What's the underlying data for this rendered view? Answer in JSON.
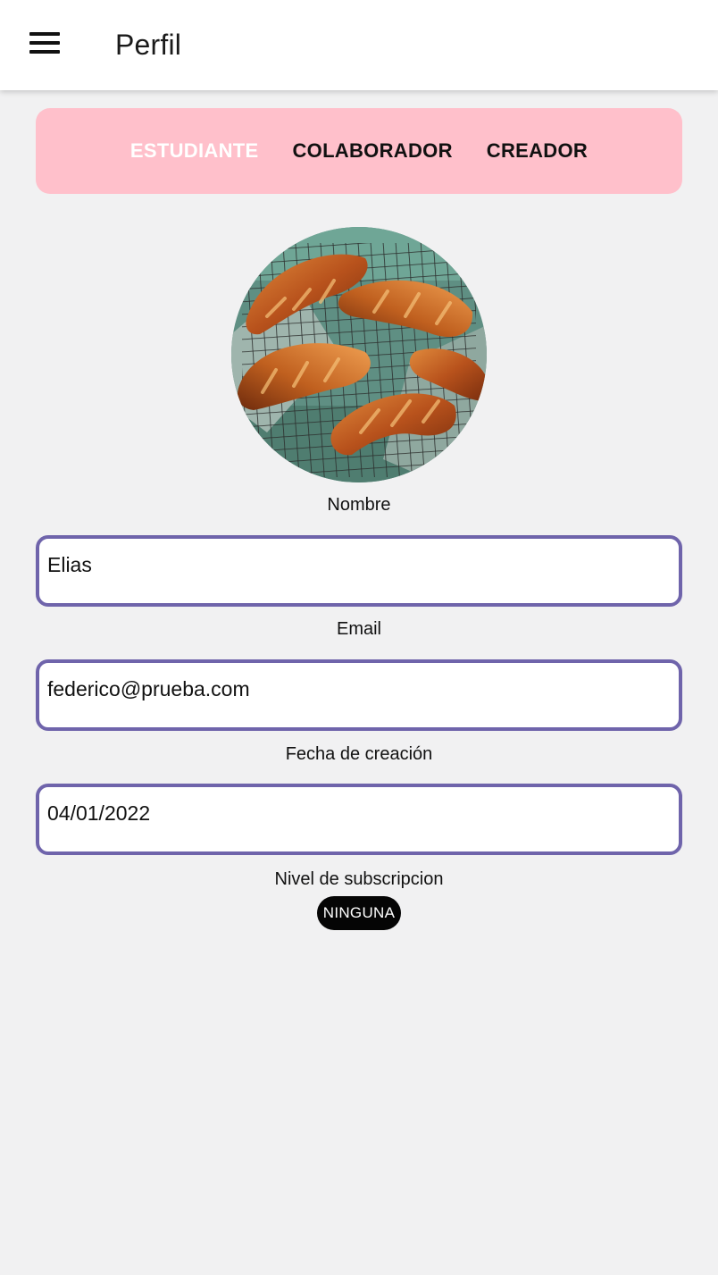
{
  "app_bar": {
    "title": "Perfil"
  },
  "role_tabs": [
    {
      "label": "ESTUDIANTE",
      "active": true
    },
    {
      "label": "COLABORADOR",
      "active": false
    },
    {
      "label": "CREADOR",
      "active": false
    }
  ],
  "avatar": {
    "icon": "croissant-photo"
  },
  "form": {
    "name": {
      "label": "Nombre",
      "value": "Elias"
    },
    "email": {
      "label": "Email",
      "value": "federico@prueba.com"
    },
    "created": {
      "label": "Fecha de creación",
      "value": "04/01/2022"
    },
    "subscription": {
      "label": "Nivel de subscripcion",
      "badge": "NINGUNA"
    }
  },
  "colors": {
    "tab_bar_bg": "#ffc0cb",
    "input_border": "#6f64ab",
    "badge_bg": "#050505",
    "page_bg": "#f1f1f2"
  }
}
